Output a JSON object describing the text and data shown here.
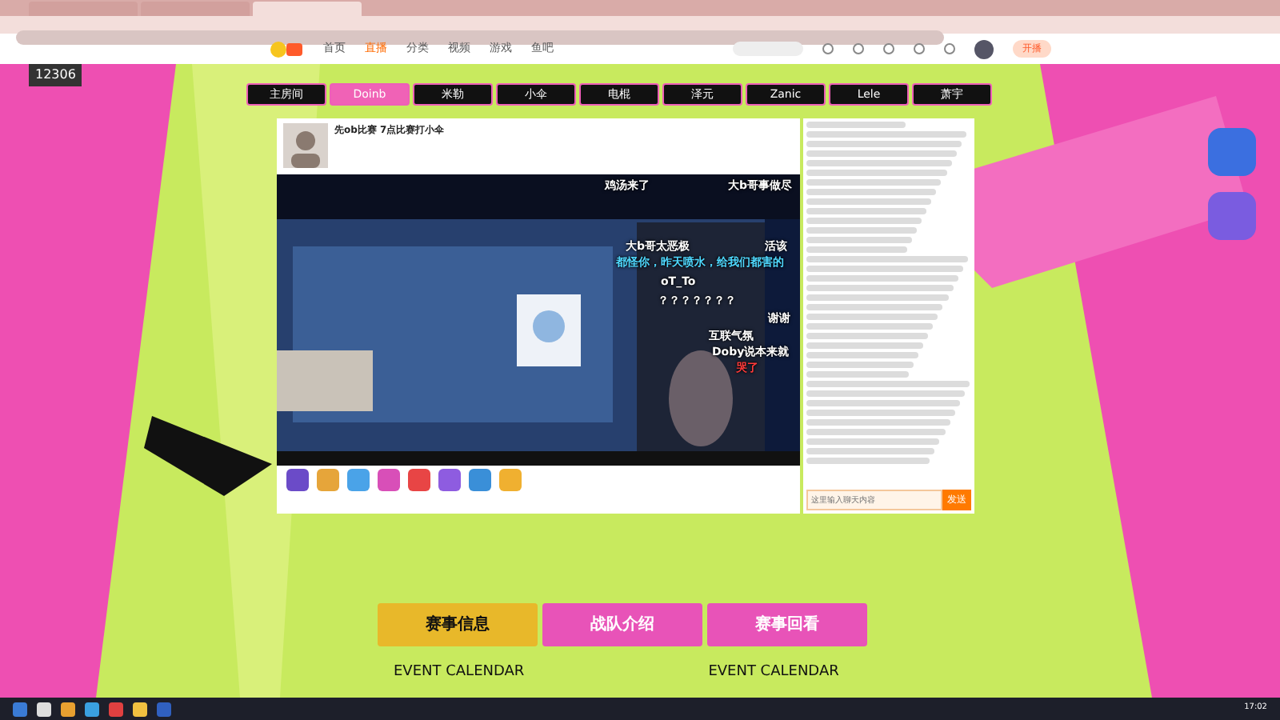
{
  "browser_tabs": [
    {
      "selected": false
    },
    {
      "selected": false
    },
    {
      "selected": true
    }
  ],
  "site_nav": [
    {
      "label": "首页",
      "selected": false
    },
    {
      "label": "直播",
      "selected": true
    },
    {
      "label": "分类",
      "selected": false
    },
    {
      "label": "视频",
      "selected": false
    },
    {
      "label": "游戏",
      "selected": false
    },
    {
      "label": "鱼吧",
      "selected": false
    }
  ],
  "start_button": "开播",
  "badge_number": "12306",
  "room_tabs": [
    {
      "label": "主房间",
      "selected": false
    },
    {
      "label": "Doinb",
      "selected": true
    },
    {
      "label": "米勒",
      "selected": false
    },
    {
      "label": "小伞",
      "selected": false
    },
    {
      "label": "电棍",
      "selected": false
    },
    {
      "label": "泽元",
      "selected": false
    },
    {
      "label": "Zanic",
      "selected": false
    },
    {
      "label": "Lele",
      "selected": false
    },
    {
      "label": "萧宇",
      "selected": false
    }
  ],
  "stream": {
    "title": "先ob比赛 7点比赛打小伞",
    "danmaku": [
      {
        "text": "鸡汤来了",
        "color": "#ffffff"
      },
      {
        "text": "大b哥事做尽",
        "color": "#ffffff"
      },
      {
        "text": "大b哥太恶极",
        "color": "#ffffff"
      },
      {
        "text": "活该",
        "color": "#ffffff"
      },
      {
        "text": "都怪你，昨天喷水，给我们都害的",
        "color": "#4fd8ff"
      },
      {
        "text": "oT_To",
        "color": "#ffffff"
      },
      {
        "text": "？？？？？？？",
        "color": "#ffffff"
      },
      {
        "text": "谢谢",
        "color": "#ffffff"
      },
      {
        "text": "互联气氛",
        "color": "#ffffff"
      },
      {
        "text": "Doby说本来就",
        "color": "#ffffff"
      },
      {
        "text": "哭了",
        "color": "#ff3b3b"
      }
    ]
  },
  "chat": {
    "input_placeholder": "这里输入聊天内容",
    "send_label": "发送"
  },
  "sections": [
    {
      "label": "赛事信息",
      "selected": true
    },
    {
      "label": "战队介绍",
      "selected": false
    },
    {
      "label": "赛事回看",
      "selected": false
    }
  ],
  "event_headers": [
    "EVENT CALENDAR",
    "EVENT CALENDAR"
  ],
  "taskbar": {
    "time": "17:02"
  }
}
